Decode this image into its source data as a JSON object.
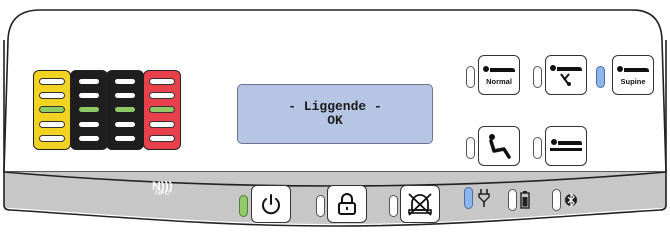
{
  "panel": {
    "body_color": "#ffffff",
    "bottom_bar_color": "#c7c7c7",
    "outline_color": "#222222"
  },
  "meter": {
    "columns": [
      {
        "color": "yellow",
        "segments": [
          false,
          false,
          true,
          false,
          false
        ]
      },
      {
        "color": "black",
        "segments": [
          false,
          false,
          true,
          false,
          false
        ]
      },
      {
        "color": "black",
        "segments": [
          false,
          false,
          true,
          false,
          false
        ]
      },
      {
        "color": "red",
        "segments": [
          false,
          false,
          true,
          false,
          false
        ]
      }
    ]
  },
  "lcd": {
    "line1": "- Liggende -",
    "line2": "OK"
  },
  "positions": {
    "normal_label": "Normal",
    "supine_label": "Supine",
    "normal_icon": "lying-figure-icon",
    "no_legs_icon": "lying-figure-crossed-icon",
    "supine_icon": "lying-figure-icon",
    "sitting_icon": "sitting-figure-icon",
    "bed_icon": "lying-in-bed-icon"
  },
  "indicators": {
    "supine_active": true,
    "power_active": true,
    "connection_active": true
  },
  "bottom_bar": {
    "nfc_label": "NFC",
    "power_icon": "power-icon",
    "lock_icon": "lock-icon",
    "alarm_off_icon": "alarm-off-icon",
    "plug_icon": "plug-icon",
    "battery_icon": "battery-icon",
    "bluetooth_icon": "bluetooth-icon"
  }
}
